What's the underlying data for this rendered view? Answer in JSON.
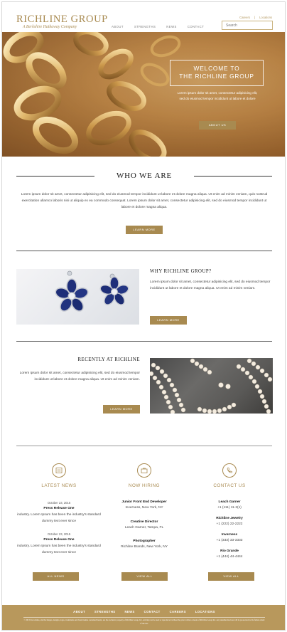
{
  "header": {
    "logo_title": "RICHLINE GROUP",
    "logo_subtitle": "A Berkshire Hathaway Company",
    "nav": [
      "ABOUT",
      "STRENGTHS",
      "NEWS",
      "CONTACT"
    ],
    "util_links": [
      "Careers",
      "|",
      "Locations"
    ],
    "search_placeholder": "Search"
  },
  "hero": {
    "title": "WELCOME TO\nTHE RICHLINE GROUP",
    "text": "Lorem ipsum dolor sit amet, consectetur adipisicing elit, sed do eiusmod tempor incididunt ut labore et dolore",
    "button": "ABOUT US"
  },
  "who": {
    "title": "WHO WE ARE",
    "text": "Lorem ipsum dolor sit amet, consectetur adipisicing elit, sed do eiusmod tempor incididunt ut labore et dolore magna aliqua. Ut enim ad minim veniam, quis nostrud exercitation ullamco laboris nisi ut aliquip ex ea commodo consequat. Lorem ipsum dolor sit amet, consectetur adipisicing elit, sed do eiusmod tempor incididunt ut labore et dolore magna aliqua.",
    "button": "LEARN MORE"
  },
  "why": {
    "title": "WHY RICHLINE GROUP?",
    "text": "Lorem ipsum dolor sit amet, consectetur adipisicing elit, sed do eiusmod tempor incididunt ut labore et dolore magna aliqua. Ut enim ad minim veniam.",
    "button": "LEARN MORE"
  },
  "recent": {
    "title": "RECENTLY AT RICHLINE",
    "text": "Lorem ipsum dolor sit amet, consectetur adipisicing elit, sed do eiusmod tempor incididunt ut labore et dolore magna aliqua. Ut enim ad minim veniam.",
    "button": "LEARN MORE"
  },
  "news": {
    "title": "LATEST NEWS",
    "items": [
      {
        "date": "October 23, 2015",
        "headline": "Press Release One",
        "body": "industry. Lorem Ipsum has been the industry's standard dummy text ever since"
      },
      {
        "date": "October 23, 2015",
        "headline": "Press Release One",
        "body": "industry. Lorem Ipsum has been the industry's standard dummy text ever since"
      }
    ],
    "button": "ALL NEWS"
  },
  "hiring": {
    "title": "NOW HIRING",
    "items": [
      {
        "title": "Junior Front End Developer",
        "sub": "Inverness, New York, NY"
      },
      {
        "title": "Creative Director",
        "sub": "Leach Garner, Tampa, FL"
      },
      {
        "title": "Photographer",
        "sub": "Richline Brands, New York, NY"
      }
    ],
    "button": "VIEW ALL"
  },
  "contact": {
    "title": "CONTACT US",
    "items": [
      {
        "title": "Leach Garner",
        "sub": "+1 (111) 11-2(1)"
      },
      {
        "title": "Richline Jewelry",
        "sub": "+1 (222) 22-2222"
      },
      {
        "title": "Inverness",
        "sub": "+1 (333) 33-3333"
      },
      {
        "title": "Rio Grande",
        "sub": "+1 (444) 44-4444"
      }
    ],
    "button": "VIEW ALL"
  },
  "footer": {
    "nav": [
      "ABOUT",
      "STRENGTHS",
      "NEWS",
      "CONTACT",
      "CAREERS",
      "LOCATIONS"
    ],
    "copyright": "© 2015 the website, and the images, designs, logos, trademarks and brand names contained herein, are the exclusive property of Richline Group, Inc. and may not be used or reproduced without the prior written consent of Richline Group Inc. Any unauthorized use will be prosecuted to the fullest extent of the law."
  },
  "colors": {
    "accent": "#a88a50",
    "footer_bg": "#b8985c"
  }
}
